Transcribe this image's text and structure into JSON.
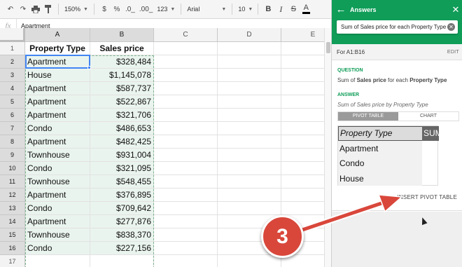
{
  "toolbar": {
    "zoom": "150%",
    "currency": "$",
    "percent": "%",
    "decrease_decimals": ".0_",
    "increase_decimals": ".00_",
    "more_formats": "123",
    "font": "Arial",
    "font_size": "10",
    "bold": "B",
    "italic": "I",
    "strikethrough": "S",
    "text_color": "A"
  },
  "formula_bar": {
    "fx": "fx",
    "value": "Apartment"
  },
  "grid": {
    "columns": [
      "A",
      "B",
      "C",
      "D",
      "E"
    ],
    "row_numbers": [
      "1",
      "2",
      "3",
      "4",
      "5",
      "6",
      "7",
      "8",
      "9",
      "10",
      "11",
      "12",
      "13",
      "14",
      "15",
      "16",
      "17"
    ],
    "header": {
      "a": "Property Type",
      "b": "Sales price"
    },
    "rows": [
      {
        "a": "Apartment",
        "b": "$328,484"
      },
      {
        "a": "House",
        "b": "$1,145,078"
      },
      {
        "a": "Apartment",
        "b": "$587,737"
      },
      {
        "a": "Apartment",
        "b": "$522,867"
      },
      {
        "a": "Apartment",
        "b": "$321,706"
      },
      {
        "a": "Condo",
        "b": "$486,653"
      },
      {
        "a": "Apartment",
        "b": "$482,425"
      },
      {
        "a": "Townhouse",
        "b": "$931,004"
      },
      {
        "a": "Condo",
        "b": "$321,095"
      },
      {
        "a": "Townhouse",
        "b": "$548,455"
      },
      {
        "a": "Apartment",
        "b": "$376,895"
      },
      {
        "a": "Condo",
        "b": "$709,642"
      },
      {
        "a": "Apartment",
        "b": "$277,876"
      },
      {
        "a": "Townhouse",
        "b": "$838,370"
      },
      {
        "a": "Condo",
        "b": "$227,156"
      }
    ]
  },
  "panel": {
    "title": "Answers",
    "search_value": "Sum of Sales price for each Property Type",
    "range": "For A1:B16",
    "edit": "EDIT",
    "question_label": "QUESTION",
    "question_parts": [
      "Sum of ",
      "Sales price",
      " for each ",
      "Property Type"
    ],
    "answer_label": "ANSWER",
    "answer_text": "Sum of Sales price by Property Type",
    "tabs": [
      "PIVOT TABLE",
      "CHART"
    ],
    "pivot": {
      "header_row_label": "Property Type",
      "header_value_label": "SUM o",
      "rows": [
        "Apartment",
        "Condo",
        "House"
      ]
    },
    "insert_label": "INSERT PIVOT TABLE"
  },
  "annotation": {
    "step": "3",
    "color": "#d9473b"
  },
  "colors": {
    "accent_green": "#0f9d58",
    "selection_blue": "#4285f4",
    "range_tint": "#eaf4ee"
  }
}
